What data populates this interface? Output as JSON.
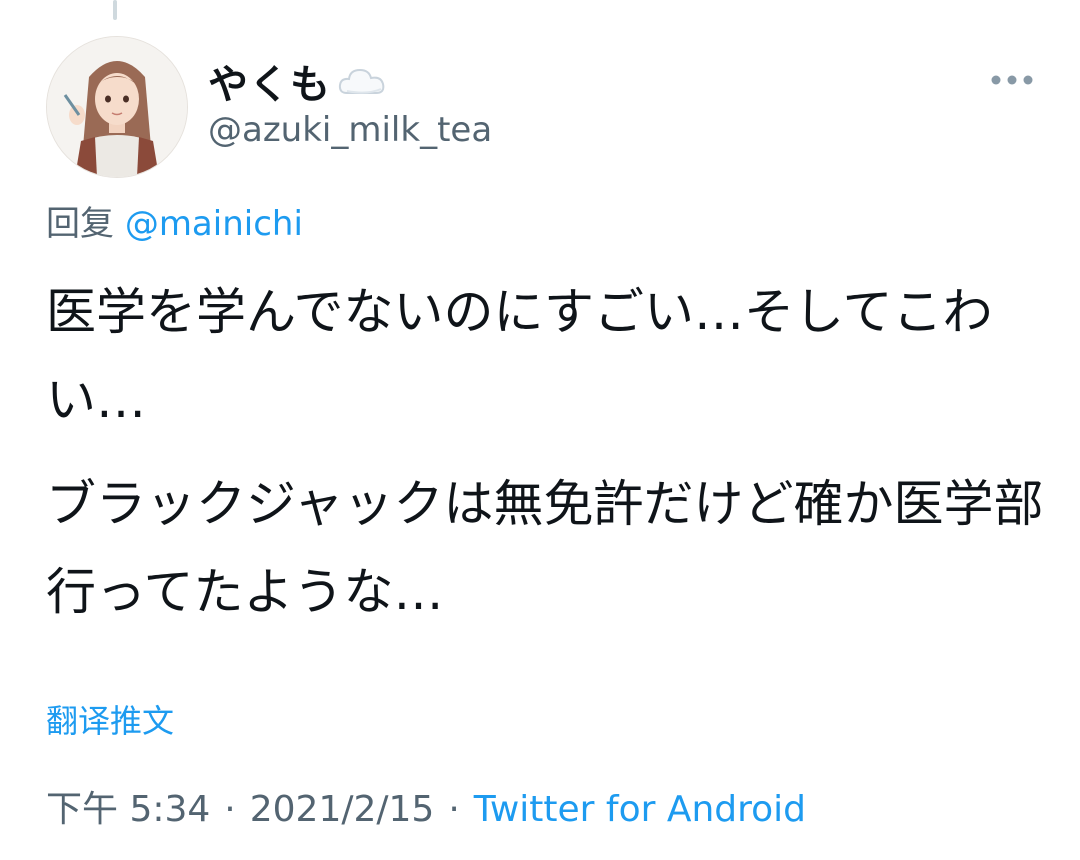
{
  "tweet": {
    "author": {
      "display_name": "やくも",
      "name_icon": "cloud-icon",
      "handle": "@azuki_milk_tea",
      "avatar": "illustrated-girl-avatar"
    },
    "more_icon": "more-horizontal-icon",
    "reply": {
      "prefix": "回复",
      "mention": "@mainichi"
    },
    "text": {
      "paragraph_1": "医学を学んでないのにすごい…そしてこわい…",
      "paragraph_2": "ブラックジャックは無免許だけど確か医学部行ってたような…"
    },
    "translate_label": "翻译推文",
    "meta": {
      "time": "下午 5:34",
      "date": "2021/2/15",
      "separator": "·",
      "source": "Twitter for Android"
    }
  },
  "colors": {
    "accent": "#1d9bf0",
    "secondary_text": "#536471",
    "primary_text": "#0f1419"
  }
}
